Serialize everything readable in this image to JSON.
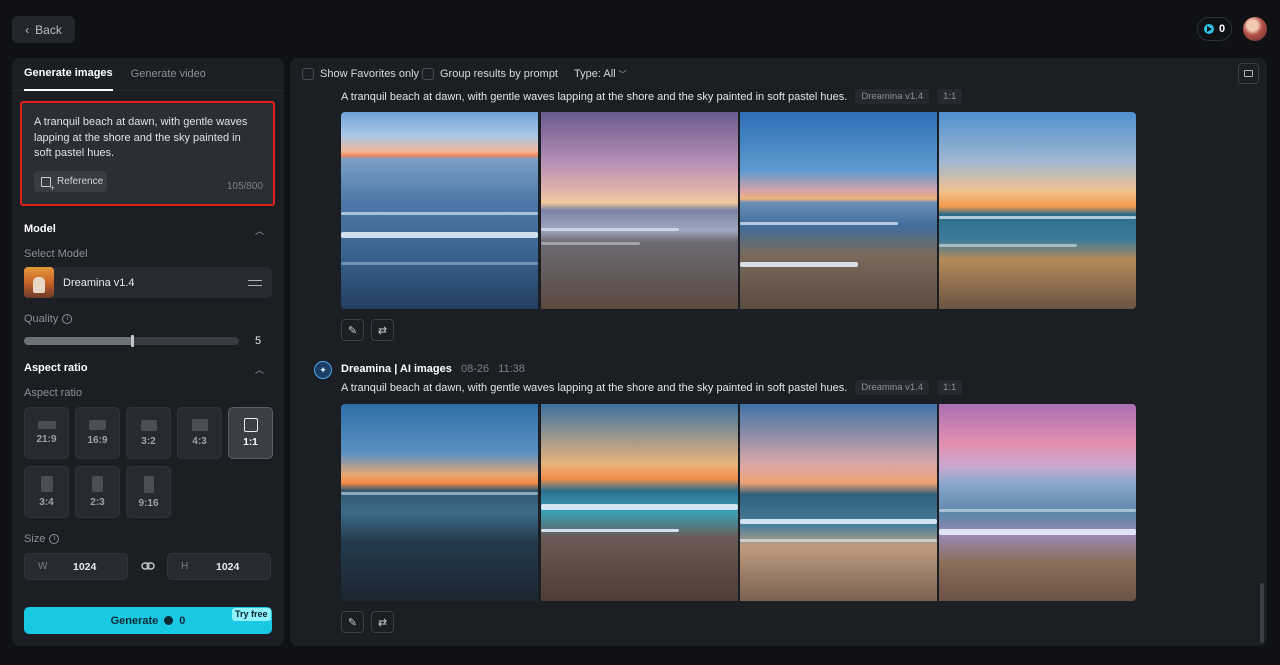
{
  "header": {
    "back_label": "Back",
    "credits": "0"
  },
  "left": {
    "tabs": [
      {
        "label": "Generate images",
        "active": true
      },
      {
        "label": "Generate video",
        "active": false
      }
    ],
    "prompt": {
      "text": "A tranquil beach at dawn, with gentle waves lapping at the shore and the sky painted in soft pastel hues.",
      "reference_label": "Reference",
      "char_count": "105/800"
    },
    "model": {
      "heading": "Model",
      "select_label": "Select Model",
      "selected": "Dreamina v1.4"
    },
    "quality": {
      "label": "Quality",
      "value": "5",
      "fraction": 0.5
    },
    "aspect": {
      "heading": "Aspect ratio",
      "label": "Aspect ratio",
      "options": [
        "21:9",
        "16:9",
        "3:2",
        "4:3",
        "1:1",
        "3:4",
        "2:3",
        "9:16"
      ],
      "selected": "1:1"
    },
    "size": {
      "label": "Size",
      "w_label": "W",
      "w_value": "1024",
      "h_label": "H",
      "h_value": "1024"
    },
    "generate": {
      "label": "Generate",
      "cost": "0",
      "badge": "Try free"
    }
  },
  "right": {
    "toolbar": {
      "favorites_label": "Show Favorites only",
      "group_label": "Group results by prompt",
      "type_label": "Type: All"
    },
    "groups": [
      {
        "prompt": "A tranquil beach at dawn, with gentle waves lapping at the shore and the sky painted in soft pastel hues.",
        "model_chip": "Dreamina v1.4",
        "ratio_chip": "1:1"
      },
      {
        "title": "Dreamina | AI images",
        "date": "08-26",
        "time": "11:38",
        "prompt": "A tranquil beach at dawn, with gentle waves lapping at the shore and the sky painted in soft pastel hues.",
        "model_chip": "Dreamina v1.4",
        "ratio_chip": "1:1"
      }
    ]
  },
  "colors": {
    "accent": "#19c8e2",
    "highlight_border": "#e0201e"
  },
  "icons": [
    "chevron-left-icon",
    "coin-icon",
    "avatar",
    "reference-icon",
    "chevron-up-icon",
    "tune-icon",
    "info-icon",
    "link-icon",
    "folder-icon",
    "chevron-down-icon",
    "dreamina-logo-icon",
    "edit-icon",
    "regenerate-icon"
  ]
}
